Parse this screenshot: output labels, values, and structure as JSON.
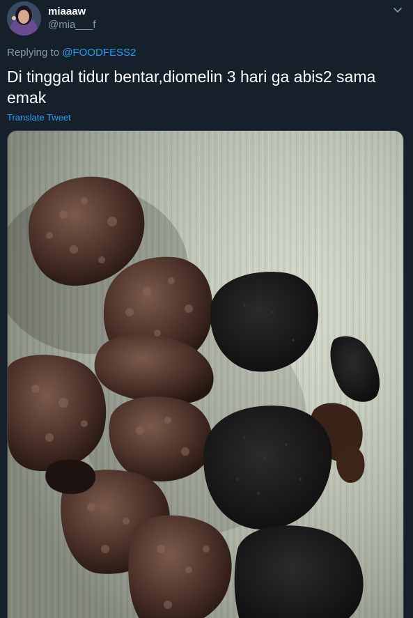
{
  "author": {
    "display_name": "miaaaw",
    "handle": "@mia___f",
    "avatar_icon": "user-avatar"
  },
  "reply": {
    "prefix": "Replying to",
    "mention": "@FOODFESS2"
  },
  "tweet": {
    "text": "Di tinggal tidur bentar,diomelin 3 hari ga abis2 sama emak",
    "translate_label": "Translate Tweet"
  },
  "media": {
    "description_icon": "photo-of-burnt-cookies-and-muffins"
  },
  "colors": {
    "background": "#15202b",
    "link": "#1da1f2",
    "secondary_text": "#8899a6"
  }
}
